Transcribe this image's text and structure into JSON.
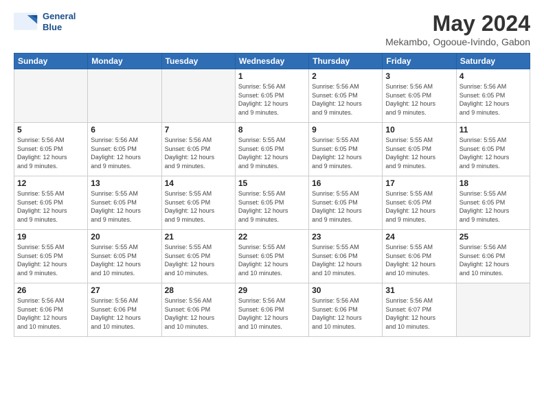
{
  "header": {
    "logo_line1": "General",
    "logo_line2": "Blue",
    "title": "May 2024",
    "subtitle": "Mekambo, Ogooue-Ivindo, Gabon"
  },
  "weekdays": [
    "Sunday",
    "Monday",
    "Tuesday",
    "Wednesday",
    "Thursday",
    "Friday",
    "Saturday"
  ],
  "weeks": [
    [
      {
        "day": "",
        "info": ""
      },
      {
        "day": "",
        "info": ""
      },
      {
        "day": "",
        "info": ""
      },
      {
        "day": "1",
        "info": "Sunrise: 5:56 AM\nSunset: 6:05 PM\nDaylight: 12 hours\nand 9 minutes."
      },
      {
        "day": "2",
        "info": "Sunrise: 5:56 AM\nSunset: 6:05 PM\nDaylight: 12 hours\nand 9 minutes."
      },
      {
        "day": "3",
        "info": "Sunrise: 5:56 AM\nSunset: 6:05 PM\nDaylight: 12 hours\nand 9 minutes."
      },
      {
        "day": "4",
        "info": "Sunrise: 5:56 AM\nSunset: 6:05 PM\nDaylight: 12 hours\nand 9 minutes."
      }
    ],
    [
      {
        "day": "5",
        "info": "Sunrise: 5:56 AM\nSunset: 6:05 PM\nDaylight: 12 hours\nand 9 minutes."
      },
      {
        "day": "6",
        "info": "Sunrise: 5:56 AM\nSunset: 6:05 PM\nDaylight: 12 hours\nand 9 minutes."
      },
      {
        "day": "7",
        "info": "Sunrise: 5:56 AM\nSunset: 6:05 PM\nDaylight: 12 hours\nand 9 minutes."
      },
      {
        "day": "8",
        "info": "Sunrise: 5:55 AM\nSunset: 6:05 PM\nDaylight: 12 hours\nand 9 minutes."
      },
      {
        "day": "9",
        "info": "Sunrise: 5:55 AM\nSunset: 6:05 PM\nDaylight: 12 hours\nand 9 minutes."
      },
      {
        "day": "10",
        "info": "Sunrise: 5:55 AM\nSunset: 6:05 PM\nDaylight: 12 hours\nand 9 minutes."
      },
      {
        "day": "11",
        "info": "Sunrise: 5:55 AM\nSunset: 6:05 PM\nDaylight: 12 hours\nand 9 minutes."
      }
    ],
    [
      {
        "day": "12",
        "info": "Sunrise: 5:55 AM\nSunset: 6:05 PM\nDaylight: 12 hours\nand 9 minutes."
      },
      {
        "day": "13",
        "info": "Sunrise: 5:55 AM\nSunset: 6:05 PM\nDaylight: 12 hours\nand 9 minutes."
      },
      {
        "day": "14",
        "info": "Sunrise: 5:55 AM\nSunset: 6:05 PM\nDaylight: 12 hours\nand 9 minutes."
      },
      {
        "day": "15",
        "info": "Sunrise: 5:55 AM\nSunset: 6:05 PM\nDaylight: 12 hours\nand 9 minutes."
      },
      {
        "day": "16",
        "info": "Sunrise: 5:55 AM\nSunset: 6:05 PM\nDaylight: 12 hours\nand 9 minutes."
      },
      {
        "day": "17",
        "info": "Sunrise: 5:55 AM\nSunset: 6:05 PM\nDaylight: 12 hours\nand 9 minutes."
      },
      {
        "day": "18",
        "info": "Sunrise: 5:55 AM\nSunset: 6:05 PM\nDaylight: 12 hours\nand 9 minutes."
      }
    ],
    [
      {
        "day": "19",
        "info": "Sunrise: 5:55 AM\nSunset: 6:05 PM\nDaylight: 12 hours\nand 9 minutes."
      },
      {
        "day": "20",
        "info": "Sunrise: 5:55 AM\nSunset: 6:05 PM\nDaylight: 12 hours\nand 10 minutes."
      },
      {
        "day": "21",
        "info": "Sunrise: 5:55 AM\nSunset: 6:05 PM\nDaylight: 12 hours\nand 10 minutes."
      },
      {
        "day": "22",
        "info": "Sunrise: 5:55 AM\nSunset: 6:05 PM\nDaylight: 12 hours\nand 10 minutes."
      },
      {
        "day": "23",
        "info": "Sunrise: 5:55 AM\nSunset: 6:06 PM\nDaylight: 12 hours\nand 10 minutes."
      },
      {
        "day": "24",
        "info": "Sunrise: 5:55 AM\nSunset: 6:06 PM\nDaylight: 12 hours\nand 10 minutes."
      },
      {
        "day": "25",
        "info": "Sunrise: 5:56 AM\nSunset: 6:06 PM\nDaylight: 12 hours\nand 10 minutes."
      }
    ],
    [
      {
        "day": "26",
        "info": "Sunrise: 5:56 AM\nSunset: 6:06 PM\nDaylight: 12 hours\nand 10 minutes."
      },
      {
        "day": "27",
        "info": "Sunrise: 5:56 AM\nSunset: 6:06 PM\nDaylight: 12 hours\nand 10 minutes."
      },
      {
        "day": "28",
        "info": "Sunrise: 5:56 AM\nSunset: 6:06 PM\nDaylight: 12 hours\nand 10 minutes."
      },
      {
        "day": "29",
        "info": "Sunrise: 5:56 AM\nSunset: 6:06 PM\nDaylight: 12 hours\nand 10 minutes."
      },
      {
        "day": "30",
        "info": "Sunrise: 5:56 AM\nSunset: 6:06 PM\nDaylight: 12 hours\nand 10 minutes."
      },
      {
        "day": "31",
        "info": "Sunrise: 5:56 AM\nSunset: 6:07 PM\nDaylight: 12 hours\nand 10 minutes."
      },
      {
        "day": "",
        "info": ""
      }
    ]
  ]
}
